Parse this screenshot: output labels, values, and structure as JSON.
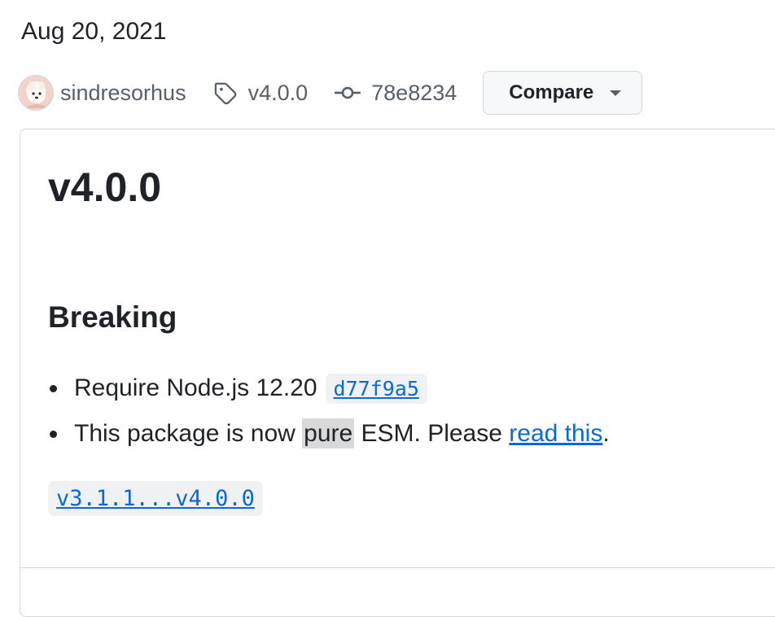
{
  "release": {
    "date": "Aug 20, 2021",
    "author": "sindresorhus",
    "tag": "v4.0.0",
    "commit": "78e8234",
    "compare_label": "Compare"
  },
  "icons": {
    "tag": "tag-icon",
    "commit": "git-commit-icon",
    "dropdown": "triangle-down-icon",
    "avatar": "user-avatar"
  },
  "body": {
    "title": "v4.0.0",
    "heading": "Breaking",
    "items": [
      {
        "text": "Require Node.js 12.20",
        "commit": "d77f9a5"
      },
      {
        "prefix": "This package is now ",
        "highlight": "pure",
        "middle": " ESM. Please ",
        "link": "read this",
        "suffix": "."
      }
    ],
    "compare_range": "v3.1.1...v4.0.0"
  },
  "colors": {
    "link": "#0969da",
    "text": "#1f2328",
    "muted": "#57606a",
    "border": "#d0d7de"
  }
}
